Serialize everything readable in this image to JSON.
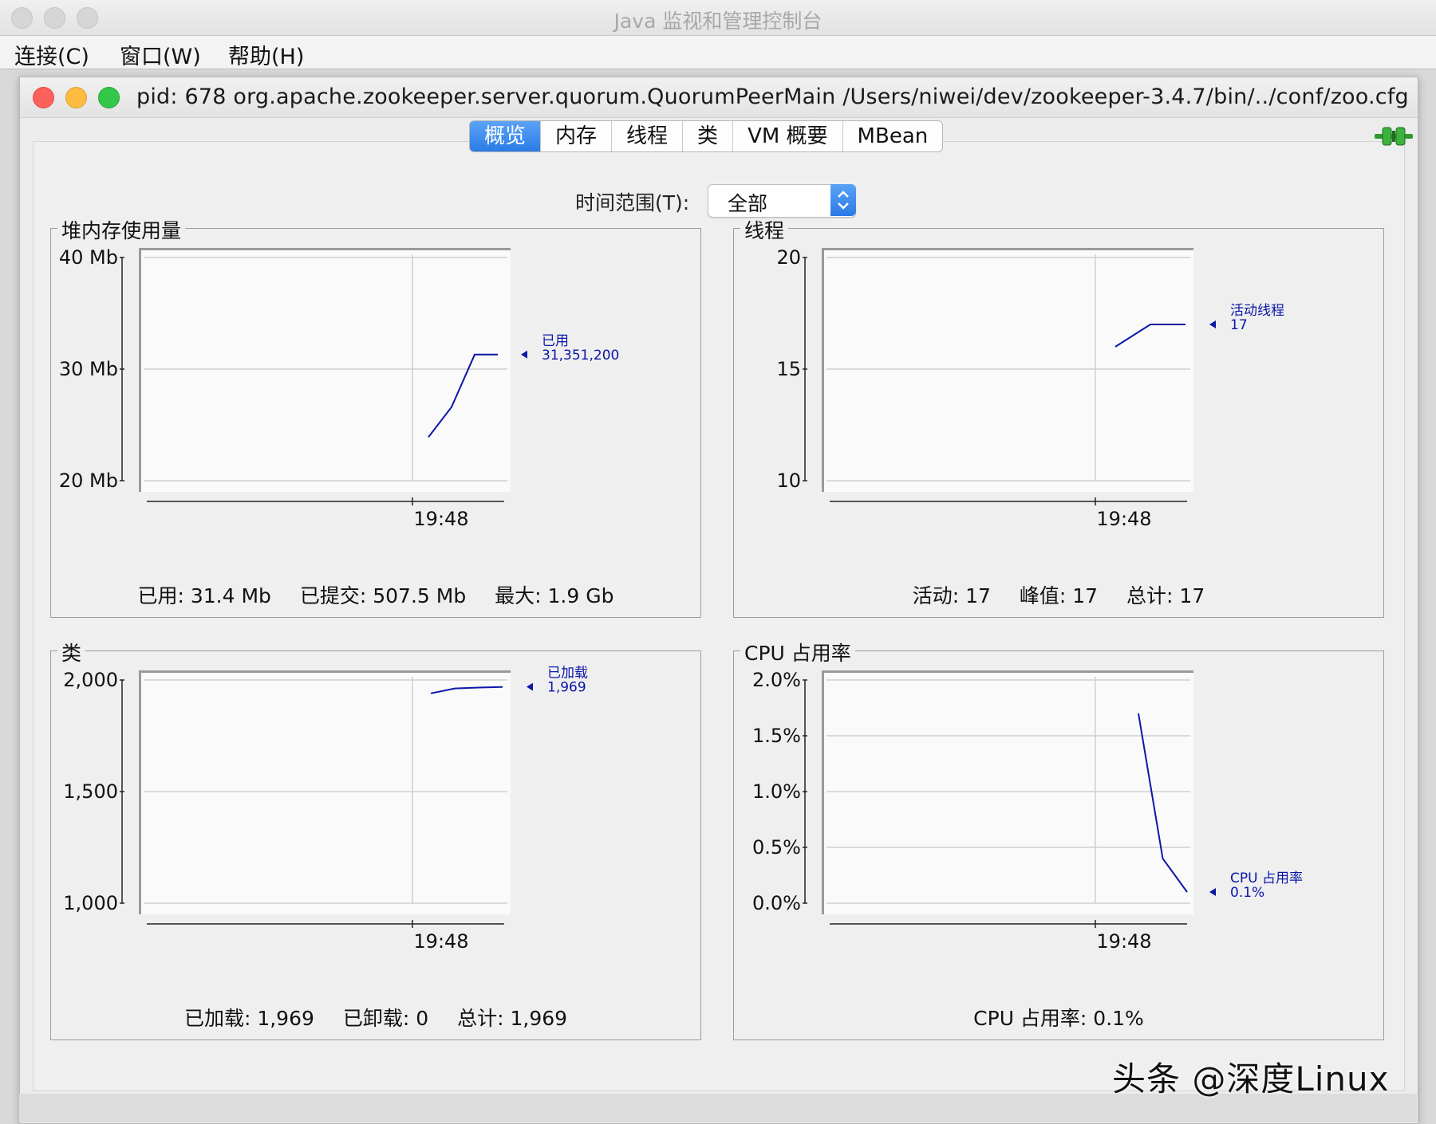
{
  "window": {
    "title": "Java 监视和管理控制台",
    "menu": [
      "连接(C)",
      "窗口(W)",
      "帮助(H)"
    ],
    "inner_title": "pid: 678 org.apache.zookeeper.server.quorum.QuorumPeerMain /Users/niwei/dev/zookeeper-3.4.7/bin/../conf/zoo.cfg"
  },
  "tabs": [
    "概览",
    "内存",
    "线程",
    "类",
    "VM 概要",
    "MBean"
  ],
  "active_tab": "概览",
  "time_range": {
    "label": "时间范围(T):",
    "value": "全部"
  },
  "panels": {
    "heap": {
      "title": "堆内存使用量",
      "stats": [
        "已用: 31.4 Mb",
        "已提交: 507.5 Mb",
        "最大: 1.9 Gb"
      ]
    },
    "threads": {
      "title": "线程",
      "stats": [
        "活动: 17",
        "峰值: 17",
        "总计: 17"
      ]
    },
    "classes": {
      "title": "类",
      "stats": [
        "已加载: 1,969",
        "已卸载: 0",
        "总计: 1,969"
      ]
    },
    "cpu": {
      "title": "CPU 占用率",
      "stats": [
        "CPU 占用率: 0.1%"
      ]
    }
  },
  "chart_data": [
    {
      "type": "line",
      "title": "堆内存使用量",
      "y_ticks": [
        "20 Mb",
        "30 Mb",
        "40 Mb"
      ],
      "ylim": [
        20,
        40
      ],
      "x_ticks": [
        "19:48"
      ],
      "series": [
        {
          "name": "已用",
          "value_label": "31,351,200",
          "values": [
            23.9,
            26.6,
            31.3,
            31.3
          ]
        }
      ]
    },
    {
      "type": "line",
      "title": "线程",
      "y_ticks": [
        "10",
        "15",
        "20"
      ],
      "ylim": [
        10,
        20
      ],
      "x_ticks": [
        "19:48"
      ],
      "series": [
        {
          "name": "活动线程",
          "value_label": "17",
          "values": [
            16,
            17,
            17
          ]
        }
      ]
    },
    {
      "type": "line",
      "title": "类",
      "y_ticks": [
        "1,000",
        "1,500",
        "2,000"
      ],
      "ylim": [
        1000,
        2000
      ],
      "x_ticks": [
        "19:48"
      ],
      "series": [
        {
          "name": "已加载",
          "value_label": "1,969",
          "values": [
            1940,
            1962,
            1966,
            1969
          ]
        }
      ]
    },
    {
      "type": "line",
      "title": "CPU 占用率",
      "y_ticks": [
        "0.0%",
        "0.5%",
        "1.0%",
        "1.5%",
        "2.0%"
      ],
      "ylim": [
        0,
        2
      ],
      "x_ticks": [
        "19:48"
      ],
      "series": [
        {
          "name": "CPU 占用率",
          "value_label": "0.1%",
          "values": [
            1.7,
            0.4,
            0.1
          ]
        }
      ]
    }
  ],
  "watermark": "头条 @深度Linux"
}
